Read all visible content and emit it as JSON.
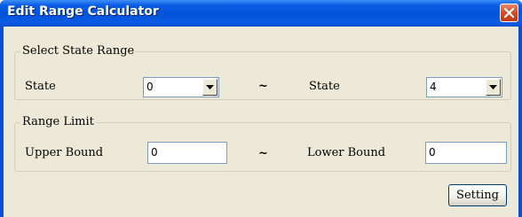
{
  "window": {
    "title": "Edit Range Calculator",
    "close_icon": "close-icon"
  },
  "state_group": {
    "title": "Select State Range",
    "state_from_label": "State",
    "state_from_value": "0",
    "separator": "~",
    "state_to_label": "State",
    "state_to_value": "4"
  },
  "range_group": {
    "title": "Range Limit",
    "upper_label": "Upper Bound",
    "upper_value": "0",
    "separator": "~",
    "lower_label": "Lower Bound",
    "lower_value": "0"
  },
  "buttons": {
    "setting_label": "Setting"
  },
  "colors": {
    "titlebar": "#0453d9",
    "client_bg": "#ece9d8",
    "close_button": "#d84a22"
  }
}
